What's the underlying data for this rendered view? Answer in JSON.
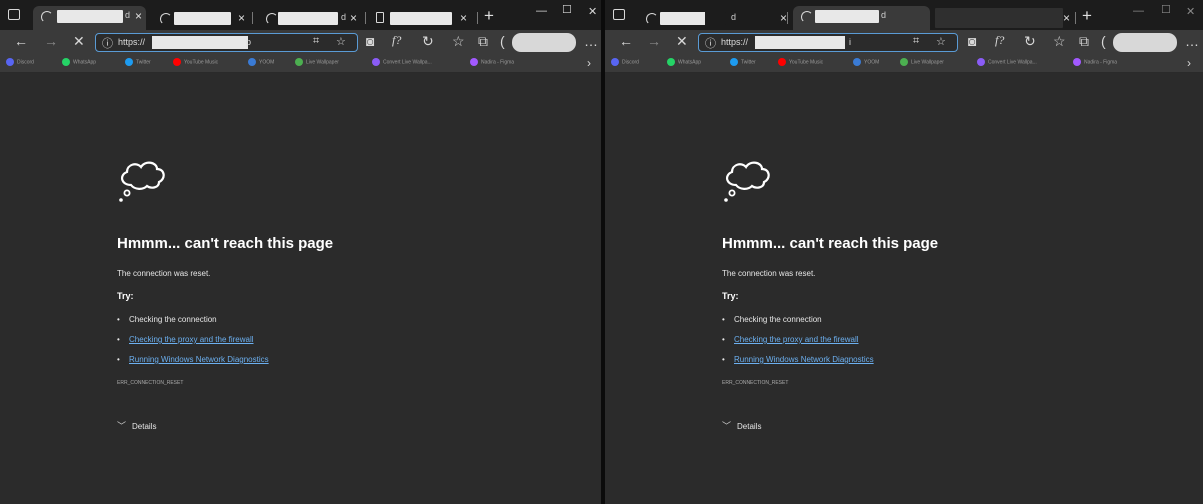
{
  "windows": [
    {
      "id": "left",
      "tabs": [
        {
          "title": "d",
          "close": "×",
          "active": true
        },
        {
          "title": "",
          "close": "×",
          "active": false
        },
        {
          "title": "d",
          "close": "×",
          "active": false
        },
        {
          "title": "",
          "close": "×",
          "active": false
        }
      ],
      "url": "https://",
      "url_tail": "p"
    },
    {
      "id": "right",
      "tabs": [
        {
          "title": "",
          "close": "",
          "active": false
        },
        {
          "title": "d",
          "close": "×",
          "active": true
        },
        {
          "title": "d",
          "close": "",
          "active": false
        },
        {
          "title": "",
          "close": "×",
          "active": false
        }
      ],
      "url": "https://",
      "url_tail": "i"
    }
  ],
  "toolbar_icons": [
    "back-icon",
    "forward-icon",
    "stop-icon",
    "info-icon",
    "reader-icon",
    "favorite-add-icon",
    "extension-icon",
    "formula-icon",
    "refresh-icon",
    "favorites-icon",
    "collections-icon",
    "more-icon"
  ],
  "bookmarks": [
    {
      "label": "Discord",
      "color": "#5865f2"
    },
    {
      "label": "WhatsApp",
      "color": "#25d366"
    },
    {
      "label": "Twitter",
      "color": "#1d9bf0"
    },
    {
      "label": "YouTube Music",
      "color": "#ff0000"
    },
    {
      "label": "YOOM",
      "color": "#3a7bd5"
    },
    {
      "label": "Live Wallpaper",
      "color": "#4caf50"
    },
    {
      "label": "Convert Live Wallpa...",
      "color": "#8a5cf6"
    },
    {
      "label": "Nadira - Figma",
      "color": "#a259ff"
    }
  ],
  "error": {
    "title": "Hmmm... can't reach this page",
    "message": "The connection was reset.",
    "try_label": "Try:",
    "items": [
      {
        "text": "Checking the connection",
        "link": false
      },
      {
        "text": "Checking the proxy and the firewall",
        "link": true
      },
      {
        "text": "Running Windows Network Diagnostics",
        "link": true
      }
    ],
    "code": "ERR_CONNECTION_RESET",
    "details_label": "Details"
  }
}
